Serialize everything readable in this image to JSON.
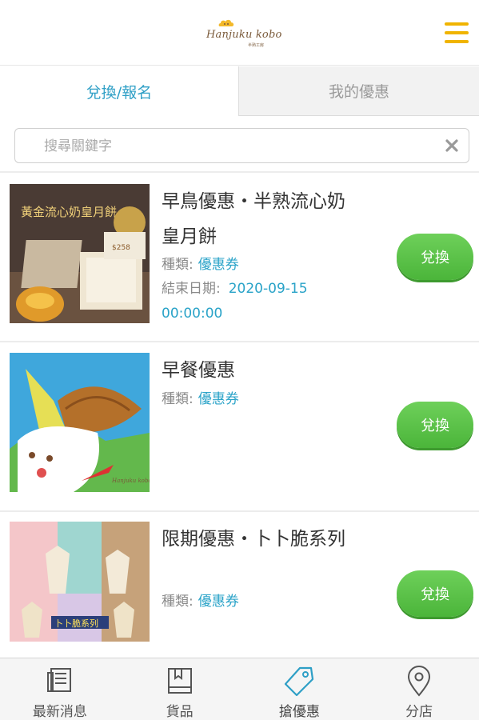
{
  "header": {
    "logo_text": "Hanjuku kobo",
    "logo_sub": "半熟工房"
  },
  "tabs": [
    {
      "label": "兌換/報名",
      "active": true
    },
    {
      "label": "我的優惠",
      "active": false
    }
  ],
  "search": {
    "placeholder": "搜尋關鍵字",
    "value": ""
  },
  "coupons": [
    {
      "title": "早鳥優惠・半熟流心奶皇月餅",
      "type_label": "種類:",
      "type_value": "優惠券",
      "end_label": "結束日期:",
      "end_date": "2020-09-15",
      "end_time": "00:00:00",
      "button": "兌換",
      "image": {
        "headline": "黃金流心奶皇月餅",
        "price": "$258"
      }
    },
    {
      "title": "早餐優惠",
      "type_label": "種類:",
      "type_value": "優惠券",
      "button": "兌換",
      "image": {
        "brand": "Hanjuku kobo"
      }
    },
    {
      "title": "限期優惠・卜卜脆系列",
      "type_label": "種類:",
      "type_value": "優惠券",
      "button": "兌換",
      "image": {
        "headline": "卜卜脆系列"
      }
    }
  ],
  "bottom_nav": [
    {
      "label": "最新消息",
      "icon": "news-icon",
      "active": false
    },
    {
      "label": "貨品",
      "icon": "book-icon",
      "active": false
    },
    {
      "label": "搶優惠",
      "icon": "tag-icon",
      "active": true
    },
    {
      "label": "分店",
      "icon": "location-pin-icon",
      "active": false
    }
  ],
  "colors": {
    "accent_blue": "#2e9fc6",
    "menu_yellow": "#f0b400",
    "button_green": "#5cc24a"
  }
}
